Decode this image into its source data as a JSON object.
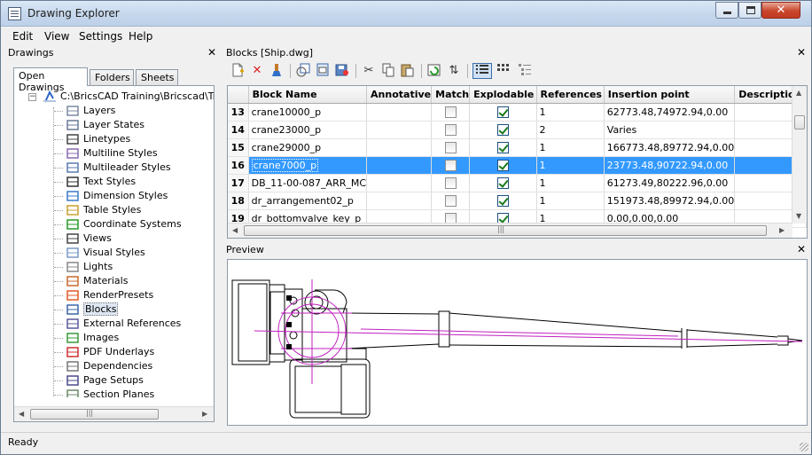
{
  "window": {
    "title": "Drawing Explorer",
    "close_glyph": "✕"
  },
  "menu": [
    "Edit",
    "View",
    "Settings",
    "Help"
  ],
  "left_panel": {
    "title": "Drawings",
    "close": "✕",
    "tabs": [
      "Open Drawings",
      "Folders",
      "Sheets"
    ],
    "root": "C:\\BricsCAD Training\\Bricscad\\Train",
    "items": [
      "Layers",
      "Layer States",
      "Linetypes",
      "Multiline Styles",
      "Multileader Styles",
      "Text Styles",
      "Dimension Styles",
      "Table Styles",
      "Coordinate Systems",
      "Views",
      "Visual Styles",
      "Lights",
      "Materials",
      "RenderPresets",
      "Blocks",
      "External References",
      "Images",
      "PDF Underlays",
      "Dependencies",
      "Page Setups",
      "Section Planes"
    ],
    "selected": "Blocks",
    "scroll_grip": "|||"
  },
  "blocks_panel": {
    "title": "Blocks [Ship.dwg]",
    "close": "✕",
    "columns": [
      "",
      "Block Name",
      "Annotative",
      "Match",
      "Explodable",
      "References",
      "Insertion point",
      "Description"
    ],
    "rows": [
      {
        "num": "13",
        "name": "crane10000_p",
        "annotative": false,
        "match": false,
        "explodable": true,
        "refs": "1",
        "insertion": "62773.48,74972.94,0.00",
        "desc": ""
      },
      {
        "num": "14",
        "name": "crane23000_p",
        "annotative": false,
        "match": false,
        "explodable": true,
        "refs": "2",
        "insertion": "Varies",
        "desc": ""
      },
      {
        "num": "15",
        "name": "crane29000_p",
        "annotative": false,
        "match": false,
        "explodable": true,
        "refs": "1",
        "insertion": "166773.48,89772.94,0.00",
        "desc": ""
      },
      {
        "num": "16",
        "name": "crane7000_p",
        "annotative": false,
        "match": false,
        "explodable": true,
        "refs": "1",
        "insertion": "23773.48,90722.94,0.00",
        "desc": "",
        "selected": true
      },
      {
        "num": "17",
        "name": "DB_11-00-087_ARR_MC",
        "annotative": false,
        "match": false,
        "explodable": true,
        "refs": "1",
        "insertion": "61273.49,80222.96,0.00",
        "desc": ""
      },
      {
        "num": "18",
        "name": "dr_arrangement02_p",
        "annotative": false,
        "match": false,
        "explodable": true,
        "refs": "1",
        "insertion": "151973.48,89972.94,0.00",
        "desc": ""
      },
      {
        "num": "19",
        "name": "dr_bottomvalve_key_p",
        "annotative": false,
        "match": false,
        "explodable": true,
        "refs": "1",
        "insertion": "0.00,0.00,0.00",
        "desc": ""
      }
    ],
    "scroll_grip": "|||"
  },
  "preview_panel": {
    "title": "Preview",
    "close": "✕"
  },
  "status": "Ready"
}
